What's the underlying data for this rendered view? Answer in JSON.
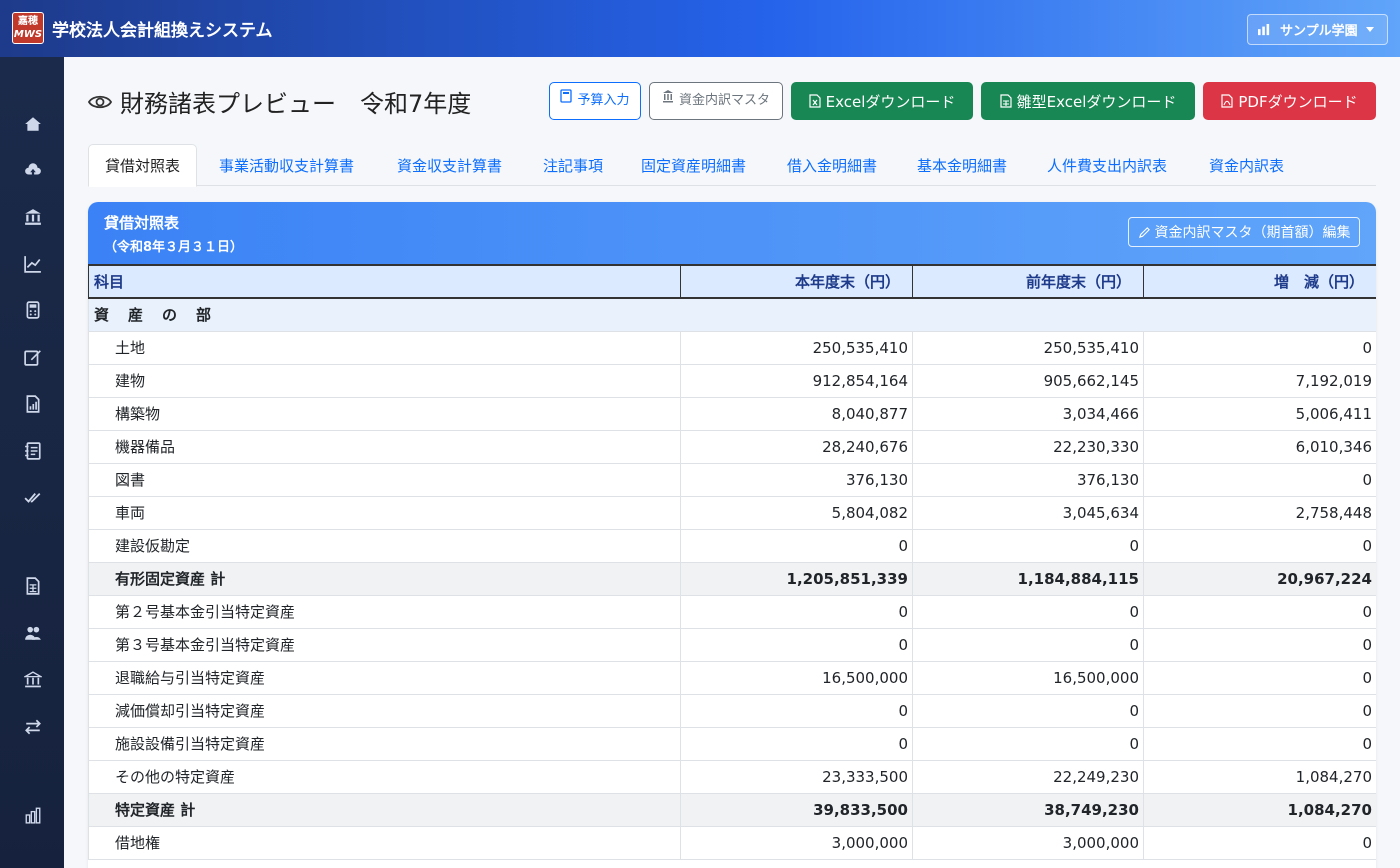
{
  "app": {
    "logo_line1": "嘉穂",
    "logo_line2": "MWS",
    "title": "学校法人会計組換えシステム",
    "org_selector": "サンプル学園"
  },
  "sidebar": {
    "items": [
      {
        "name": "home-icon"
      },
      {
        "name": "cloud-upload-icon"
      },
      {
        "name": "bank-icon"
      },
      {
        "name": "graph-up-icon"
      },
      {
        "name": "calculator-icon"
      },
      {
        "name": "pencil-square-icon"
      },
      {
        "name": "file-chart-icon"
      },
      {
        "name": "journal-icon"
      },
      {
        "name": "check-all-icon"
      },
      {
        "name": "file-spreadsheet-icon"
      },
      {
        "name": "people-icon"
      },
      {
        "name": "bank-icon-2"
      },
      {
        "name": "arrow-left-right-icon"
      },
      {
        "name": "building-graph-icon"
      }
    ]
  },
  "page": {
    "title": "財務諸表プレビュー　令和7年度",
    "buttons": {
      "budget": "予算入力",
      "fund_master": "資金内訳マスタ",
      "excel": "Excelダウンロード",
      "hina_excel": "雛型Excelダウンロード",
      "pdf": "PDFダウンロード"
    },
    "tabs": [
      "貸借対照表",
      "事業活動収支計算書",
      "資金収支計算書",
      "注記事項",
      "固定資産明細書",
      "借入金明細書",
      "基本金明細書",
      "人件費支出内訳表",
      "資金内訳表"
    ]
  },
  "card": {
    "title": "貸借対照表",
    "subtitle": "（令和8年３月３１日）",
    "edit_button": "資金内訳マスタ（期首額）編集"
  },
  "table": {
    "headers": [
      "科目",
      "本年度末（円）",
      "前年度末（円）",
      "増　減（円）"
    ],
    "section": "資　産　の　部",
    "rows": [
      {
        "label": "土地",
        "cur": "250,535,410",
        "prev": "250,535,410",
        "diff": "0"
      },
      {
        "label": "建物",
        "cur": "912,854,164",
        "prev": "905,662,145",
        "diff": "7,192,019"
      },
      {
        "label": "構築物",
        "cur": "8,040,877",
        "prev": "3,034,466",
        "diff": "5,006,411"
      },
      {
        "label": "機器備品",
        "cur": "28,240,676",
        "prev": "22,230,330",
        "diff": "6,010,346"
      },
      {
        "label": "図書",
        "cur": "376,130",
        "prev": "376,130",
        "diff": "0"
      },
      {
        "label": "車両",
        "cur": "5,804,082",
        "prev": "3,045,634",
        "diff": "2,758,448"
      },
      {
        "label": "建設仮勘定",
        "cur": "0",
        "prev": "0",
        "diff": "0"
      },
      {
        "label": "有形固定資産 計",
        "cur": "1,205,851,339",
        "prev": "1,184,884,115",
        "diff": "20,967,224",
        "subtotal": true
      },
      {
        "label": "第２号基本金引当特定資産",
        "cur": "0",
        "prev": "0",
        "diff": "0"
      },
      {
        "label": "第３号基本金引当特定資産",
        "cur": "0",
        "prev": "0",
        "diff": "0"
      },
      {
        "label": "退職給与引当特定資産",
        "cur": "16,500,000",
        "prev": "16,500,000",
        "diff": "0"
      },
      {
        "label": "減価償却引当特定資産",
        "cur": "0",
        "prev": "0",
        "diff": "0"
      },
      {
        "label": "施設設備引当特定資産",
        "cur": "0",
        "prev": "0",
        "diff": "0"
      },
      {
        "label": "その他の特定資産",
        "cur": "23,333,500",
        "prev": "22,249,230",
        "diff": "1,084,270"
      },
      {
        "label": "特定資産 計",
        "cur": "39,833,500",
        "prev": "38,749,230",
        "diff": "1,084,270",
        "subtotal": true
      },
      {
        "label": "借地権",
        "cur": "3,000,000",
        "prev": "3,000,000",
        "diff": "0"
      }
    ]
  }
}
